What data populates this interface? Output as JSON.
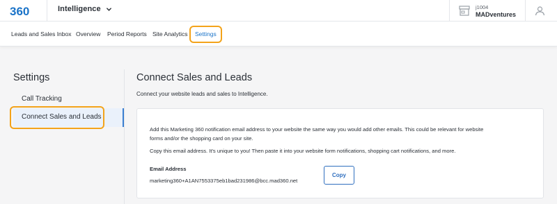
{
  "brand": {
    "logo_text": "360",
    "accent": "#1a73c8",
    "highlight": "#f3a31a"
  },
  "topbar": {
    "app_name": "Intelligence",
    "account_id": "j1004",
    "account_name": "MADventures",
    "icons": [
      "store-icon",
      "user-icon",
      "chevron-down-icon"
    ]
  },
  "tabs": [
    {
      "label": "Leads and Sales Inbox",
      "active": false
    },
    {
      "label": "Overview",
      "active": false
    },
    {
      "label": "Period Reports",
      "active": false
    },
    {
      "label": "Site Analytics",
      "active": false
    },
    {
      "label": "Settings",
      "active": true
    }
  ],
  "sidebar": {
    "title": "Settings",
    "items": [
      {
        "label": "Call Tracking",
        "active": false
      },
      {
        "label": "Connect Sales and Leads",
        "active": true
      }
    ]
  },
  "main": {
    "title": "Connect Sales and Leads",
    "subtitle": "Connect your website leads and sales to Intelligence.",
    "paragraph1_line1": "Add this Marketing 360 notification email address to your website the same way you would add other emails. This could be relevant for website",
    "paragraph1_line2": "forms and/or the shopping card on your site.",
    "paragraph2": "Copy this email address. It's unique to you! Then paste it into your website form notifications, shopping cart notifications, and more.",
    "email_label": "Email Address",
    "email_value": "marketing360+A1AN7553375eb1bad231986@bcc.mad360.net",
    "copy_label": "Copy"
  }
}
